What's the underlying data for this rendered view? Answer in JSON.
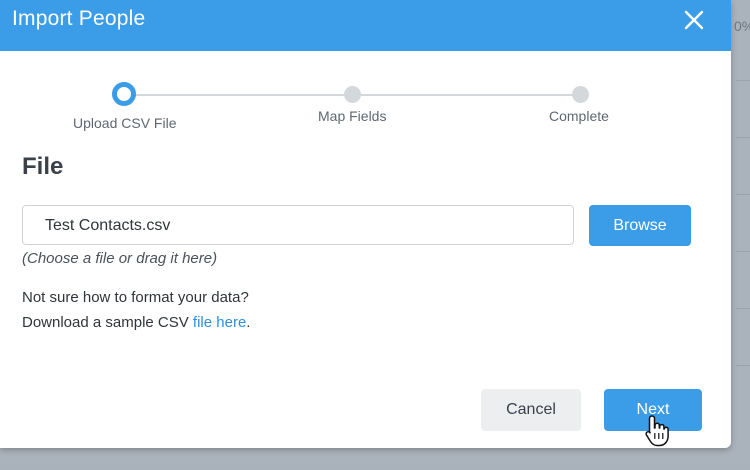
{
  "background": {
    "partial_text": "0%"
  },
  "dialog": {
    "title": "Import People",
    "steps": [
      {
        "label": "Upload CSV File",
        "state": "active"
      },
      {
        "label": "Map Fields",
        "state": "pending"
      },
      {
        "label": "Complete",
        "state": "pending"
      }
    ],
    "section_title": "File",
    "file_input": {
      "value": "Test Contacts.csv"
    },
    "browse_label": "Browse",
    "hint": "(Choose a file or drag it here)",
    "help": {
      "line1": "Not sure how to format your data?",
      "line2_prefix": "Download a sample CSV ",
      "line2_link": "file here",
      "line2_suffix": "."
    },
    "buttons": {
      "cancel": "Cancel",
      "next": "Next"
    }
  },
  "colors": {
    "accent": "#3b9ce8",
    "overlay": "#aab2bb",
    "inactive_step": "#d5d8db"
  }
}
